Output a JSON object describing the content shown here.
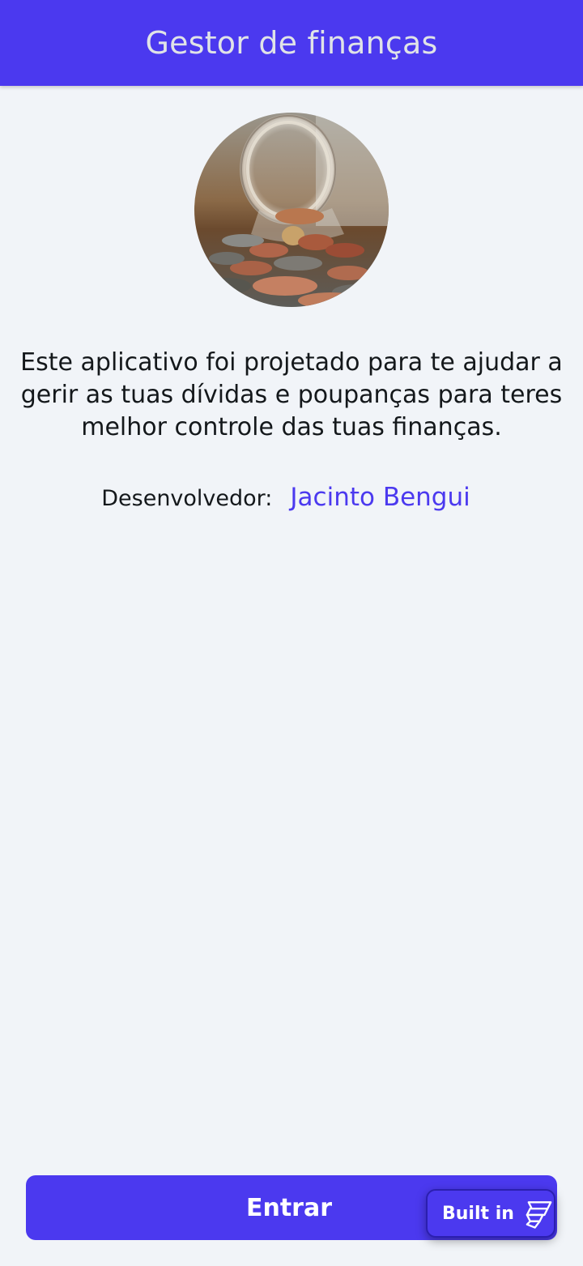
{
  "header": {
    "title": "Gestor de finanças"
  },
  "hero": {
    "image_icon": "coin-jar-photo"
  },
  "about": {
    "description": "Este aplicativo foi projetado para te ajudar a gerir as tuas dívidas e poupanças para teres melhor controle das tuas finanças.",
    "developer_label": "Desenvolvedor:",
    "developer_name": "Jacinto Bengui"
  },
  "actions": {
    "enter_label": "Entrar"
  },
  "badge": {
    "label": "Built in",
    "icon": "flutterflow-logo-icon"
  },
  "colors": {
    "primary": "#4b39ef",
    "background": "#f1f4f8",
    "header_text": "#e0e3e7",
    "body_text": "#14181b"
  }
}
